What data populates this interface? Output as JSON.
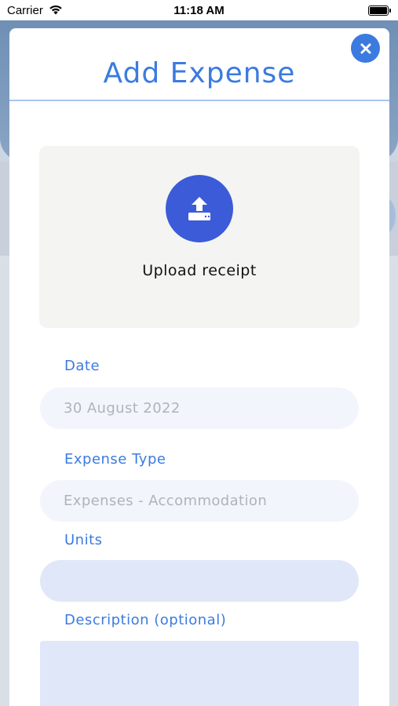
{
  "status_bar": {
    "carrier": "Carrier",
    "time": "11:18 AM"
  },
  "modal": {
    "title": "Add Expense",
    "close_icon": "close-icon",
    "upload": {
      "label": "Upload receipt",
      "icon": "upload-icon"
    },
    "fields": {
      "date": {
        "label": "Date",
        "value": "30 August 2022"
      },
      "expense_type": {
        "label": "Expense Type",
        "value": "Expenses - Accommodation"
      },
      "units": {
        "label": "Units",
        "value": ""
      },
      "description": {
        "label": "Description (optional)",
        "value": ""
      }
    }
  },
  "colors": {
    "accent": "#3b7be0",
    "upload_button": "#3b5bd8",
    "field_bg": "#f2f5fb",
    "active_field_bg": "#dfe7f8"
  }
}
